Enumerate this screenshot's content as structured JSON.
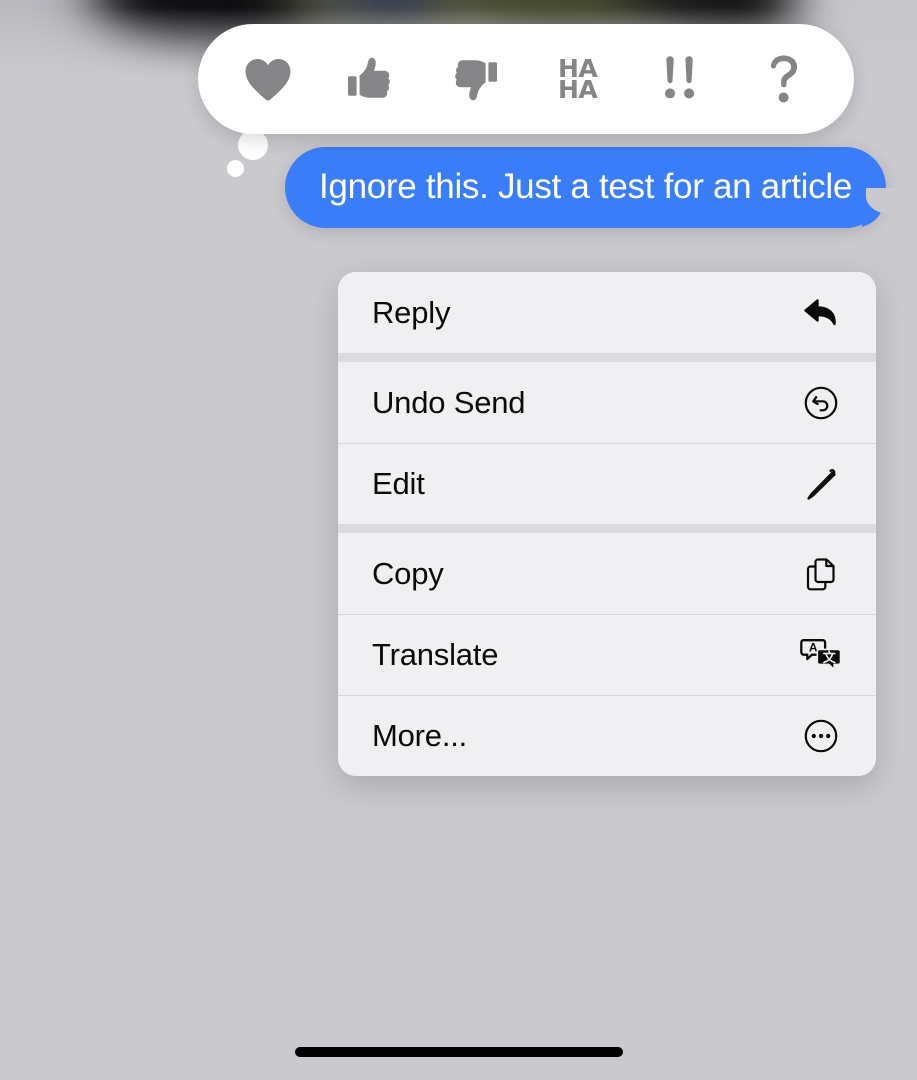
{
  "colors": {
    "screen_background": "#C9C9CE",
    "bubble_blue": "#3A7DF8",
    "bubble_text": "#FFFFFF",
    "menu_background": "#F0F0F2",
    "menu_text": "#0B0B0C",
    "menu_group_separator": "#DBDBDF",
    "menu_row_divider": "#D6D6DC",
    "tapback_bar_background": "#FFFFFF",
    "tapback_icon": "#858588",
    "home_indicator": "#000000"
  },
  "tapback": {
    "name": "tapback-reaction-bar",
    "items": [
      {
        "id": "heart",
        "icon": "heart-icon",
        "label": "Love"
      },
      {
        "id": "thumbsup",
        "icon": "thumbs-up-icon",
        "label": "Like"
      },
      {
        "id": "thumbsdown",
        "icon": "thumbs-down-icon",
        "label": "Dislike"
      },
      {
        "id": "haha",
        "icon": "haha-icon",
        "label": "HA HA",
        "line1": "HA",
        "line2": "HA"
      },
      {
        "id": "exclamation",
        "icon": "double-exclamation-icon",
        "label": "!!"
      },
      {
        "id": "question",
        "icon": "question-mark-icon",
        "label": "?"
      }
    ]
  },
  "message": {
    "name": "outgoing-message-bubble",
    "text": "Ignore this. Just a test for an article",
    "sender": "outgoing",
    "tail": "right"
  },
  "context_menu": {
    "name": "message-context-menu",
    "groups": [
      {
        "items": [
          {
            "label": "Reply",
            "icon": "reply-arrow-icon"
          }
        ]
      },
      {
        "items": [
          {
            "label": "Undo Send",
            "icon": "undo-circle-arrow-icon"
          },
          {
            "label": "Edit",
            "icon": "pencil-icon"
          }
        ]
      },
      {
        "items": [
          {
            "label": "Copy",
            "icon": "doc-on-doc-icon"
          },
          {
            "label": "Translate",
            "icon": "translate-bubbles-icon"
          },
          {
            "label": "More...",
            "icon": "ellipsis-circle-icon"
          }
        ]
      }
    ]
  },
  "system": {
    "home_indicator": "home-indicator"
  }
}
